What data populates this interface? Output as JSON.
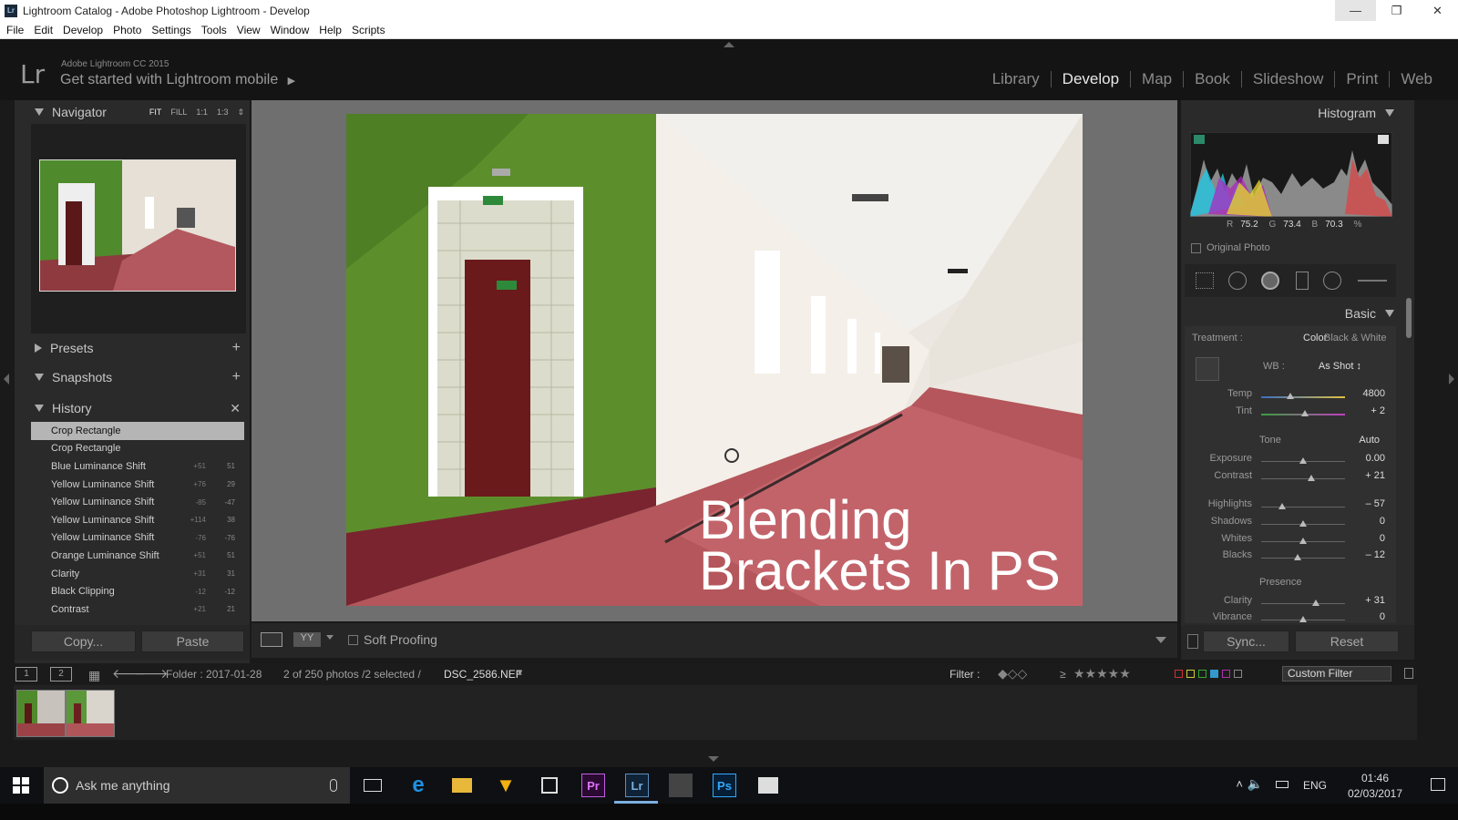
{
  "window": {
    "app_badge": "Lr",
    "title": "Lightroom Catalog - Adobe Photoshop Lightroom - Develop"
  },
  "menu": [
    "File",
    "Edit",
    "Develop",
    "Photo",
    "Settings",
    "Tools",
    "View",
    "Window",
    "Help",
    "Scripts"
  ],
  "identity": {
    "logo": "Lr",
    "version": "Adobe Lightroom CC 2015",
    "mobile_prompt": "Get started with Lightroom mobile"
  },
  "modules": [
    "Library",
    "Develop",
    "Map",
    "Book",
    "Slideshow",
    "Print",
    "Web"
  ],
  "active_module": "Develop",
  "left": {
    "navigator": {
      "title": "Navigator",
      "options": [
        "FIT",
        "FILL",
        "1:1",
        "1:3"
      ],
      "selected": "FIT"
    },
    "presets": "Presets",
    "snapshots": "Snapshots",
    "history": {
      "title": "History",
      "items": [
        {
          "label": "Crop Rectangle",
          "v1": "",
          "v2": ""
        },
        {
          "label": "Crop Rectangle",
          "v1": "",
          "v2": ""
        },
        {
          "label": "Blue Luminance Shift",
          "v1": "+51",
          "v2": "51"
        },
        {
          "label": "Yellow Luminance Shift",
          "v1": "+76",
          "v2": "29"
        },
        {
          "label": "Yellow Luminance Shift",
          "v1": "-85",
          "v2": "-47"
        },
        {
          "label": "Yellow Luminance Shift",
          "v1": "+114",
          "v2": "38"
        },
        {
          "label": "Yellow Luminance Shift",
          "v1": "-76",
          "v2": "-76"
        },
        {
          "label": "Orange Luminance Shift",
          "v1": "+51",
          "v2": "51"
        },
        {
          "label": "Clarity",
          "v1": "+31",
          "v2": "31"
        },
        {
          "label": "Black Clipping",
          "v1": "-12",
          "v2": "-12"
        },
        {
          "label": "Contrast",
          "v1": "+21",
          "v2": "21"
        }
      ]
    },
    "copy_label": "Copy...",
    "paste_label": "Paste"
  },
  "photo": {
    "caption_line1": "Blending",
    "caption_line2": "Brackets In PS"
  },
  "toolbar": {
    "soft_proofing": "Soft Proofing"
  },
  "right": {
    "histogram_title": "Histogram",
    "rgb": {
      "r_label": "R",
      "r": "75.2",
      "g_label": "G",
      "g": "73.4",
      "b_label": "B",
      "b": "70.3",
      "unit": "%"
    },
    "original_photo": "Original Photo",
    "basic_title": "Basic",
    "treatment_label": "Treatment :",
    "treatment_color": "Color",
    "treatment_bw": "Black & White",
    "wb_label": "WB :",
    "wb_value": "As Shot ↕",
    "tone_label": "Tone",
    "auto_label": "Auto",
    "presence_label": "Presence",
    "sliders": [
      {
        "label": "Temp",
        "value": "4800",
        "pos": 0.35
      },
      {
        "label": "Tint",
        "value": "+ 2",
        "pos": 0.52
      },
      {
        "label": "Exposure",
        "value": "0.00",
        "pos": 0.5
      },
      {
        "label": "Contrast",
        "value": "+ 21",
        "pos": 0.6
      },
      {
        "label": "Highlights",
        "value": "– 57",
        "pos": 0.25
      },
      {
        "label": "Shadows",
        "value": "0",
        "pos": 0.5
      },
      {
        "label": "Whites",
        "value": "0",
        "pos": 0.5
      },
      {
        "label": "Blacks",
        "value": "– 12",
        "pos": 0.44
      },
      {
        "label": "Clarity",
        "value": "+ 31",
        "pos": 0.65
      },
      {
        "label": "Vibrance",
        "value": "0",
        "pos": 0.5
      }
    ],
    "sync_label": "Sync...",
    "reset_label": "Reset"
  },
  "filmstrip_bar": {
    "page1": "1",
    "page2": "2",
    "folder": "Folder : 2017-01-28",
    "count": "2 of 250 photos /2 selected /",
    "filename": "DSC_2586.NEF",
    "filter_label": "Filter :",
    "rating_op": "≥",
    "custom_filter": "Custom Filter"
  },
  "taskbar": {
    "search_placeholder": "Ask me anything",
    "lang": "ENG",
    "time": "01:46",
    "date": "02/03/2017"
  }
}
